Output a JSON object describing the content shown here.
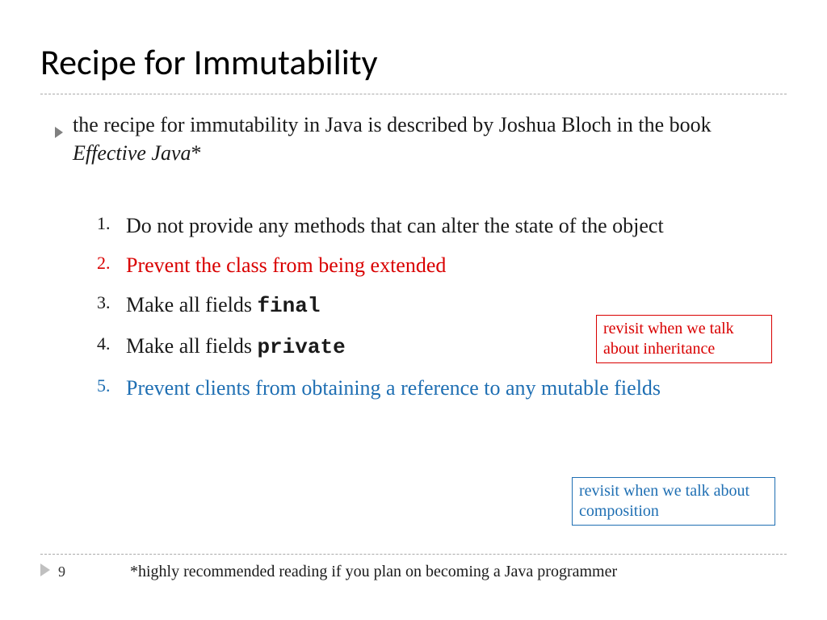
{
  "title": "Recipe for Immutability",
  "intro": {
    "text_before": "the recipe for immutability in Java is described by Joshua Bloch in the book ",
    "book": "Effective Java",
    "text_after": "*"
  },
  "items": [
    {
      "num": "1.",
      "text": "Do not provide any methods that can alter the state of the object",
      "code": "",
      "style": "normal"
    },
    {
      "num": "2.",
      "text": "Prevent the class from being extended",
      "code": "",
      "style": "red"
    },
    {
      "num": "3.",
      "text": "Make all fields ",
      "code": "final",
      "style": "normal"
    },
    {
      "num": "4.",
      "text": "Make all fields ",
      "code": "private",
      "style": "normal"
    },
    {
      "num": "5.",
      "text": "Prevent clients from obtaining a reference to any mutable fields",
      "code": "",
      "style": "blue"
    }
  ],
  "callout_red": "revisit when we talk about inheritance",
  "callout_blue": "revisit when we talk about composition",
  "page_number": "9",
  "footnote": "*highly recommended reading if you plan on becoming a Java programmer"
}
